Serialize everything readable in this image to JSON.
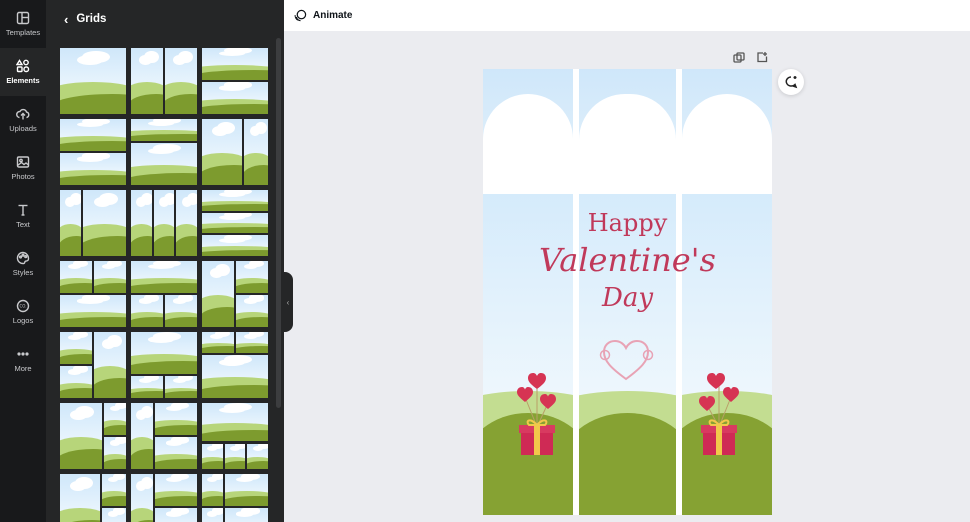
{
  "sidebar": {
    "items": [
      {
        "label": "Templates",
        "icon": "templates-icon",
        "active": false
      },
      {
        "label": "Elements",
        "icon": "elements-icon",
        "active": true
      },
      {
        "label": "Uploads",
        "icon": "uploads-icon",
        "active": false
      },
      {
        "label": "Photos",
        "icon": "photos-icon",
        "active": false
      },
      {
        "label": "Text",
        "icon": "text-icon",
        "active": false
      },
      {
        "label": "Styles",
        "icon": "styles-icon",
        "active": false
      },
      {
        "label": "Logos",
        "icon": "logos-icon",
        "active": false
      },
      {
        "label": "More",
        "icon": "more-icon",
        "active": false
      }
    ]
  },
  "panel": {
    "title": "Grids",
    "back_icon": "chevron-left-icon",
    "grid_thumbnails": 21
  },
  "topbar": {
    "animate_label": "Animate",
    "animate_icon": "animate-icon"
  },
  "canvas_tools": {
    "duplicate_icon": "duplicate-page-icon",
    "add_icon": "add-page-icon",
    "ai_icon": "magic-comment-icon"
  },
  "design": {
    "line1": "Happy",
    "line2": "Valentine's",
    "line3": "Day"
  },
  "colors": {
    "accent": "#c0395a",
    "sky": "#cfe7fa",
    "light_grass": "#b7d57a",
    "dark_grass": "#86a233",
    "panel_bg": "#252627",
    "rail_bg": "#18191b"
  }
}
